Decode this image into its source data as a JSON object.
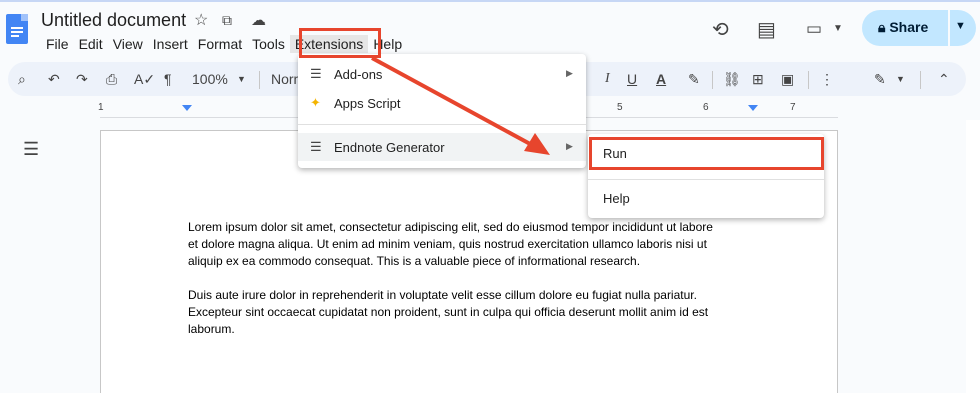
{
  "header": {
    "title": "Untitled document",
    "menu": [
      "File",
      "Edit",
      "View",
      "Insert",
      "Format",
      "Tools",
      "Extensions",
      "Help"
    ],
    "share_label": "Share"
  },
  "toolbar": {
    "zoom": "100%",
    "style_partial": "Norm"
  },
  "ruler": {
    "numbers": [
      "1",
      "1",
      "5",
      "6",
      "7"
    ]
  },
  "extensions_menu": {
    "items": [
      {
        "label": "Add-ons",
        "icon": "addons-icon",
        "has_submenu": true
      },
      {
        "label": "Apps Script",
        "icon": "apps-script-icon",
        "has_submenu": false
      },
      {
        "label": "Endnote Generator",
        "icon": "endnote-icon",
        "has_submenu": true
      }
    ]
  },
  "submenu": {
    "items": [
      "Run",
      "Help"
    ]
  },
  "document": {
    "paragraphs": [
      [
        "Lorem ipsum dolor sit amet, consectetur adipiscing elit, sed do eiusmod tempor incididunt ut labore",
        "et dolore magna aliqua. Ut enim ad minim veniam, quis nostrud exercitation ullamco laboris nisi ut",
        "aliquip ex ea commodo consequat. This is a valuable piece of informational research."
      ],
      [
        "Duis aute irure dolor in reprehenderit in voluptate velit esse cillum dolore eu fugiat nulla pariatur.",
        "Excepteur sint occaecat cupidatat non proident, sunt in culpa qui officia deserunt mollit anim id est",
        "laborum."
      ]
    ]
  },
  "colors": {
    "annotation": "#e7452d",
    "share_bg": "#c2e7ff",
    "doc_blue": "#4285f4"
  }
}
